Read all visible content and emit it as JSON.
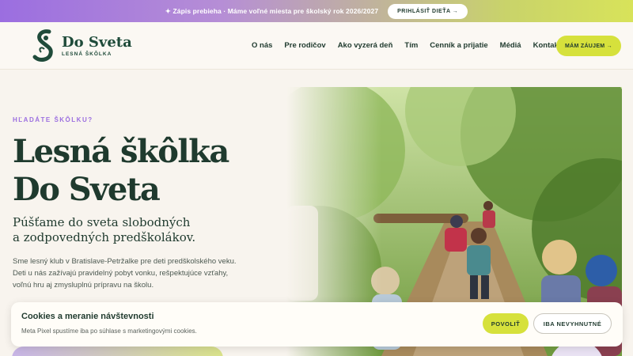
{
  "announcement": {
    "text": "✦ Zápis prebieha · Máme voľné miesta pre školský rok 2026/2027",
    "button_label": "PRIHLÁSIŤ DIEŤA →"
  },
  "logo": {
    "name": "Do Sveta",
    "sub": "LESNÁ ŠKÔLKA"
  },
  "nav": {
    "items": [
      "O nás",
      "Pre rodičov",
      "Ako vyzerá deň",
      "Tím",
      "Cenník a prijatie",
      "Médiá",
      "Kontakt"
    ]
  },
  "header": {
    "cta_label": "MÁM ZÁUJEM →"
  },
  "hero": {
    "eyebrow": "HĽADÁTE ŠKÔLKU?",
    "title_line1": "Lesná škôlka",
    "title_line2": "Do Sveta",
    "subtitle_line1": "Púšťame do sveta slobodných",
    "subtitle_line2": "a zodpovedných predškolákov.",
    "description_line1": "Sme lesný klub v Bratislave-Petržalke pre deti predškolského veku.",
    "description_line2": "Deti u nás zažívajú pravidelný pobyt vonku, rešpektujúce vzťahy,",
    "description_line3": "voľnú hru aj zmysluplnú prípravu na školu."
  },
  "cookie": {
    "title": "Cookies a meranie návštevnosti",
    "text": "Meta Pixel spustíme iba po súhlase s marketingovými cookies.",
    "allow_label": "POVOLIŤ",
    "necessary_label": "IBA NEVYHNUTNÉ"
  },
  "colors": {
    "brand_green": "#1f3a2e",
    "accent_lime": "#d6e13c",
    "accent_purple": "#9b6ee0",
    "background": "#f8f4ee"
  }
}
